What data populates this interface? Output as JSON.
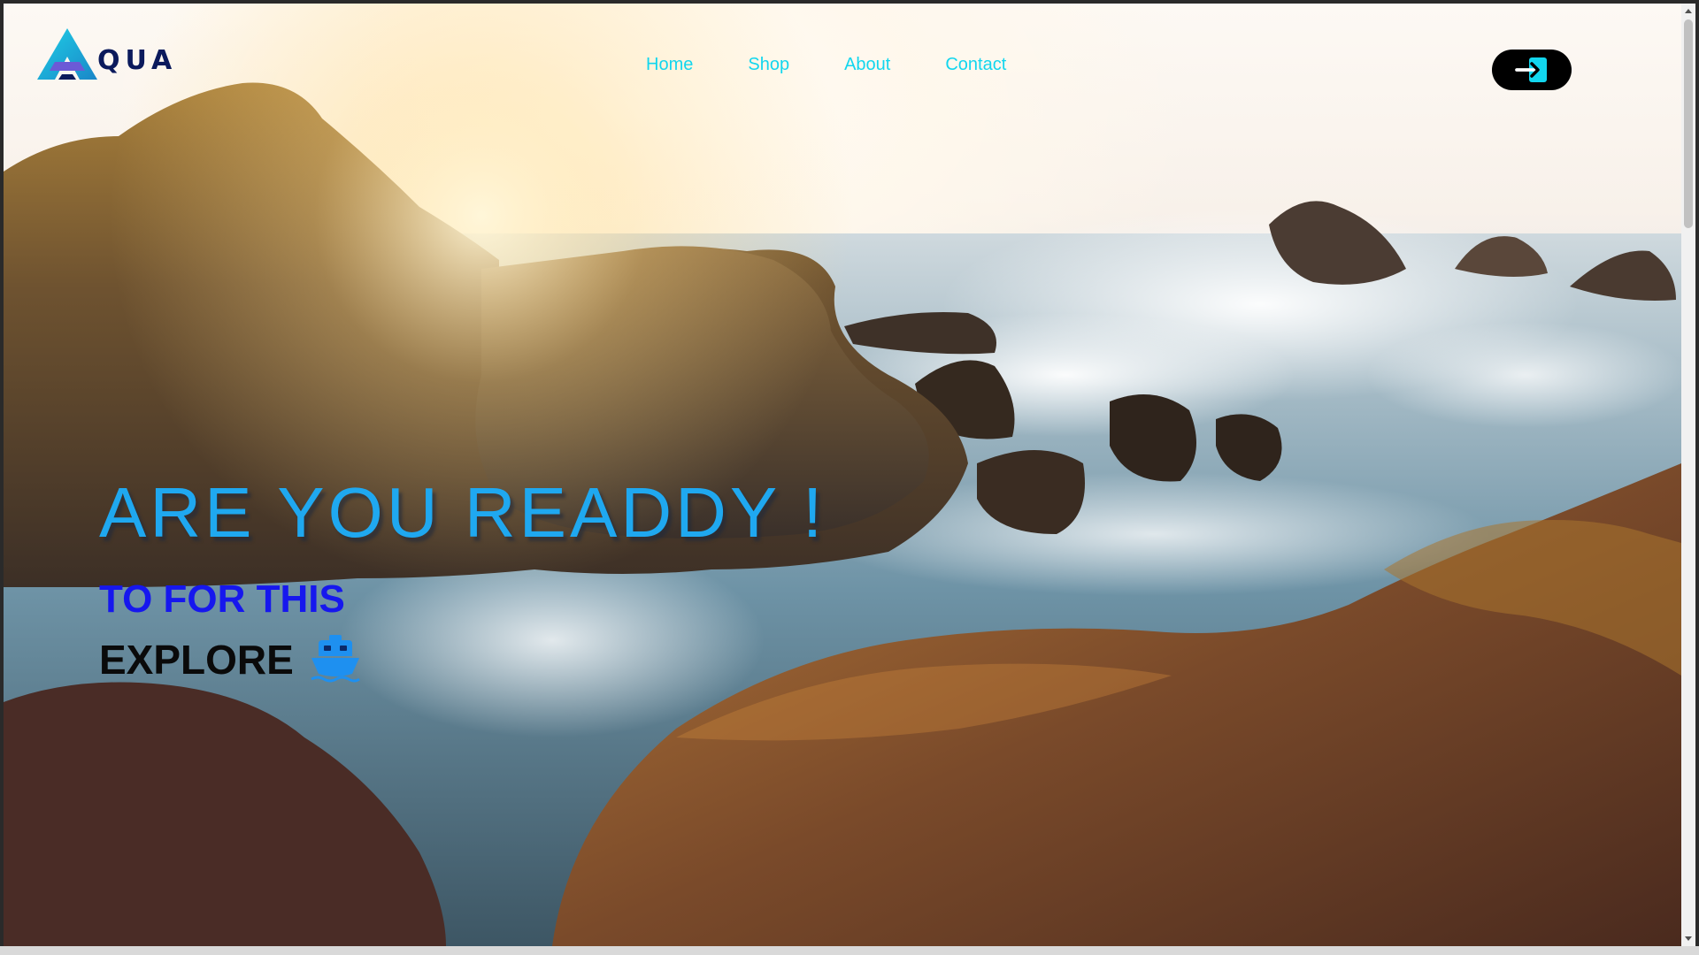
{
  "brand": {
    "logo_text": "QUA",
    "logo_icon": "triangle-a-logo-icon"
  },
  "nav": {
    "items": [
      {
        "label": "Home"
      },
      {
        "label": "Shop"
      },
      {
        "label": "About"
      },
      {
        "label": "Contact"
      }
    ]
  },
  "header": {
    "login_icon": "login-arrow-icon"
  },
  "hero": {
    "title": "ARE YOU READDY !",
    "subtitle": "TO FOR THIS",
    "explore_label": "EXPLORE",
    "explore_icon": "ship-icon",
    "background": "rocky-shoreline-sunset-photo"
  },
  "colors": {
    "nav_link": "#12d6ee",
    "hero_title": "#1fa8f0",
    "hero_subtitle": "#1617ee",
    "explore_text": "#0a0a0a",
    "ship_icon": "#1e90f0",
    "login_bg": "#000000",
    "login_icon": "#12d6ee"
  }
}
